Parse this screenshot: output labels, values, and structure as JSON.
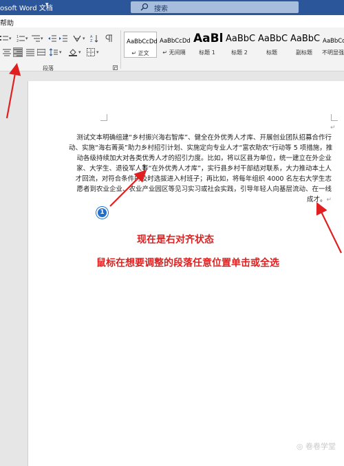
{
  "title_bar": {
    "title": "osoft Word 文档",
    "caret": "▾",
    "search": {
      "placeholder": "搜索"
    }
  },
  "menu": {
    "help": "帮助"
  },
  "ribbon": {
    "paragraph_group_label": "段落",
    "styles": [
      {
        "sample": "AaBbCcDd",
        "name": "↵ 正文",
        "selected": true
      },
      {
        "sample": "AaBbCcDd",
        "name": "↵ 无间隔",
        "selected": false
      },
      {
        "sample": "AaBl",
        "name": "标题 1",
        "selected": false
      },
      {
        "sample": "AaBbC",
        "name": "标题 2",
        "selected": false
      },
      {
        "sample": "AaBbC",
        "name": "标题",
        "selected": false
      },
      {
        "sample": "AaBbC",
        "name": "副标题",
        "selected": false
      },
      {
        "sample": "AaBbCcDd",
        "name": "不明显强",
        "selected": false
      }
    ]
  },
  "document": {
    "lines": [
      "测试文本明确组建“乡村振兴海右智库”、健全在外优秀人才库、开展创业团队招募合作行",
      "动、实施“海右菁英”助力乡村招引计划、实施定向专业人才“富农助农”行动等 5 项措施，推",
      "动各级持续加大对各类优秀人才的招引力度。比如，将以区县为单位，统一建立在外企业",
      "家、大学生、退役军人等“在外优秀人才库”，实行县乡村干部结对联系，大力推动本土人",
      "才回流，对符合条件的及时选拔进入村班子；再比如，将每年组织 4000 名左右大学生志",
      "愿者到农业企业、农业产业园区等见习实习或社会实践，引导年轻人向基层流动、在一线",
      "成才。"
    ],
    "paragraph_mark": "↵"
  },
  "annotations": {
    "badge": "1",
    "note_1": "现在是右对齐状态",
    "note_2": "鼠标在想要调整的段落任意位置单击或全选",
    "color": "#e02020"
  },
  "watermark": "◎ 卷卷学堂"
}
